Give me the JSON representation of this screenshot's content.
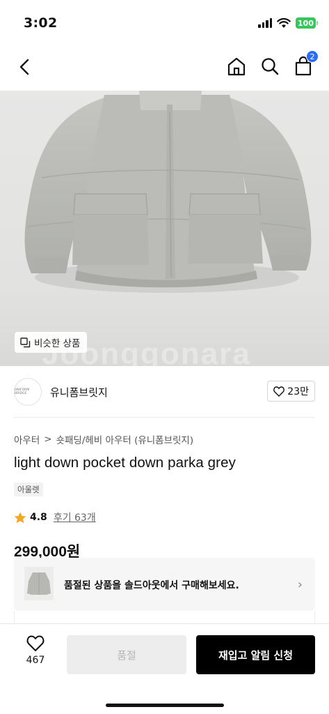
{
  "status_bar": {
    "time": "3:02",
    "battery": "100",
    "battery_color": "#35c759"
  },
  "nav": {
    "back_icon": "chevron-left-icon",
    "home_icon": "home-icon",
    "search_icon": "search-icon",
    "cart_icon": "shopping-bag-icon",
    "cart_badge": "2",
    "badge_color": "#2a6ef5"
  },
  "hero": {
    "similar_button": "비슷한 상품",
    "watermark": "Joonggonara"
  },
  "shop": {
    "logo_text": "UNIFORM BRIDGE",
    "name": "유니폼브릿지",
    "likes": "23만"
  },
  "product": {
    "breadcrumb": [
      "아우터",
      "숏패딩/헤비 아우터 (유니폼브릿지)"
    ],
    "breadcrumb_separator": ">",
    "title": "light down pocket down parka grey",
    "tag": "아울렛",
    "rating": "4.8",
    "review_link": "후기 63개",
    "price": "299,000원"
  },
  "soldout_banner": {
    "text": "품절된 상품을 솔드아웃에서 구매해보세요.",
    "chevron": "›"
  },
  "bottom_bar": {
    "wish_count": "467",
    "soldout_label": "품절",
    "restock_label": "재입고 알림 신청"
  },
  "colors": {
    "accent_star": "#f5a623",
    "primary_button": "#000000",
    "disabled_button": "#ededed"
  }
}
